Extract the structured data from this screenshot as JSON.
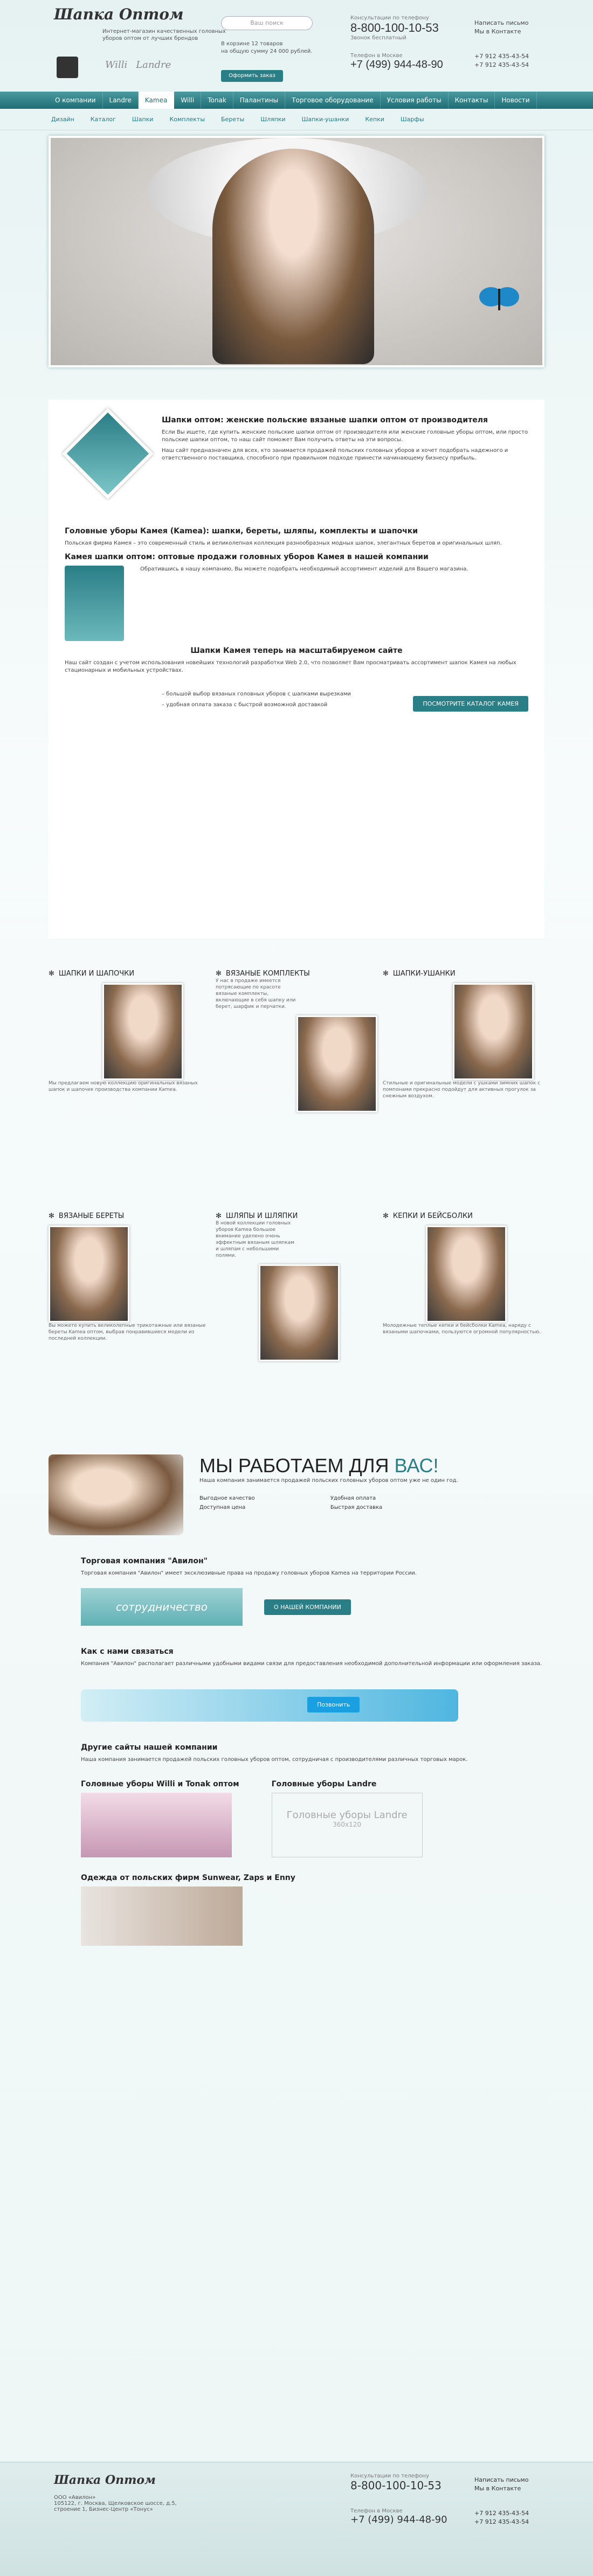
{
  "header": {
    "logo": "Шапка Оптом",
    "tagline": "Интернет-магазин качественных головных уборов оптом от лучших брендов",
    "brands": [
      "Willi",
      "Landre"
    ],
    "search_placeholder": "Ваш поиск",
    "cart_line1": "В корзине 12 товаров",
    "cart_line2": "на общую сумму 24 000 рублей.",
    "cart_button": "Оформить заказ",
    "phone1_label": "Консультации по телефону",
    "phone1": "8-800-100-10-53",
    "phone1_note": "Звонок бесплатный",
    "phone2_label": "Телефон в Москве",
    "phone2": "+7 (499) 944-48-90",
    "contacts": [
      "Написать письмо",
      "Мы в Контакте",
      "+7 912 435-43-54",
      "+7 912 435-43-54"
    ]
  },
  "nav": [
    "О компании",
    "Landre",
    "Kamea",
    "Willi",
    "Tonak",
    "Палантины",
    "Торговое оборудование",
    "Условия работы",
    "Контакты",
    "Новости"
  ],
  "subnav": [
    "Дизайн",
    "Каталог",
    "Шапки",
    "Комплекты",
    "Береты",
    "Шляпки",
    "Шапки-ушанки",
    "Кепки",
    "Шарфы"
  ],
  "intro": {
    "title": "Шапки оптом: женские польские вязаные шапки оптом от производителя",
    "p1": "Если Вы ищете, где купить женские польские шапки оптом от производителя или женские головные уборы оптом, или просто польские шапки оптом, то наш сайт поможет Вам получить ответы на эти вопросы.",
    "p2": "Наш сайт предназначен для всех, кто занимается продажей польских головных уборов и хочет подобрать надежного и ответственного поставщика, способного при правильном подходе принести начинающему бизнесу прибыль.",
    "h_kamea": "Головные уборы Камея (Kamea): шапки, береты, шляпы, комплекты и шапочки",
    "p3": "Польская фирма Камея – это современный стиль и великолепная коллекция разнообразных модных шапок, элегантных беретов и оригинальных шляп.",
    "h_kamea2": "Камея шапки оптом: оптовые продажи головных уборов Камея в нашей компании",
    "p4": "Обратившись в нашу компанию, Вы можете подобрать необходимый ассортимент изделий для Вашего магазина.",
    "h_scale": "Шапки Камея теперь на масштабируемом сайте",
    "p5": "Наш сайт создан с учетом использования новейших технологий разработки Web 2.0, что позволяет Вам просматривать ассортимент шапок Камея на любых стационарных и мобильных устройствах.",
    "list1": "– большой выбор вязаных головных уборов с шапками вырезками",
    "list2": "– удобная оплата заказа с быстрой возможной доставкой",
    "catalog_button": "ПОСМОТРИТЕ КАТАЛОГ КАМЕЯ"
  },
  "categories": [
    {
      "title": "ШАПКИ И ШАПОЧКИ",
      "text": "Мы предлагаем новую коллекцию оригинальных вязаных шапок и шапочек производства компании Kamea."
    },
    {
      "title": "ВЯЗАНЫЕ КОМПЛЕКТЫ",
      "text": "У нас в продаже имеется потрясающие по красоте вязаные комплекты, включающие в себя шапку или берет, шарфик и перчатки."
    },
    {
      "title": "ШАПКИ-УШАНКИ",
      "text": "Стильные и оригинальные модели с ушками зимних шапок с помпонами прекрасно подойдут для активных прогулок за снежным воздухом."
    },
    {
      "title": "ВЯЗАНЫЕ БЕРЕТЫ",
      "text": "Вы можете купить великолепные трикотажные или вязаные береты Kamea оптом, выбрав понравившиеся модели из последней коллекции."
    },
    {
      "title": "ШЛЯПЫ И ШЛЯПКИ",
      "text": "В новой коллекции головных уборов Kamea большое внимание уделено очень эффектным вязаным шляпкам и шляпам с небольшими полями."
    },
    {
      "title": "КЕПКИ И БЕЙСБОЛКИ",
      "text": "Молодежные теплые кепки и бейсболки Kamea, наряду с вязаными шапочками, пользуются огромной популярностью."
    }
  ],
  "work": {
    "title_a": "МЫ РАБОТАЕМ ДЛЯ ",
    "title_b": "ВАС!",
    "p1": "Наша компания занимается продажей польских головных уборов оптом уже не один год.",
    "points": [
      "Выгодное качество",
      "Удобная оплата",
      "Доступная цена",
      "Быстрая доставка"
    ],
    "company_title": "Торговая компания \"Авилон\"",
    "company_text": "Торговая компания \"Авилон\" имеет эксклюзивные права на продажу головных уборов Kamea на территории России.",
    "coop": "сотрудничество",
    "about_button": "О НАШЕЙ КОМПАНИИ",
    "contact_title": "Как с нами связаться",
    "contact_text": "Компания \"Авилон\" располагает различными удобными видами связи для предоставления необходимой дополнительной информации или оформления заказа.",
    "skype": "Позвонить",
    "other_title": "Другие сайты нашей компании",
    "other_text": "Наша компания занимается продажей польских головных уборов оптом, сотрудничая с производителями различных торговых марок.",
    "site1": "Головные уборы Willi и Tonak оптом",
    "site2": "Головные уборы Landre",
    "site2_box": "Головные уборы Landre",
    "site2_size": "360x120",
    "clothes_title": "Одежда от польских фирм Sunwear, Zaps и Enny"
  },
  "footer": {
    "company": "ООО «Авилон»",
    "addr": "105122, г. Москва, Щелковское шоссе, д.5, строение 1, Бизнес-Центр «Тонус»"
  }
}
